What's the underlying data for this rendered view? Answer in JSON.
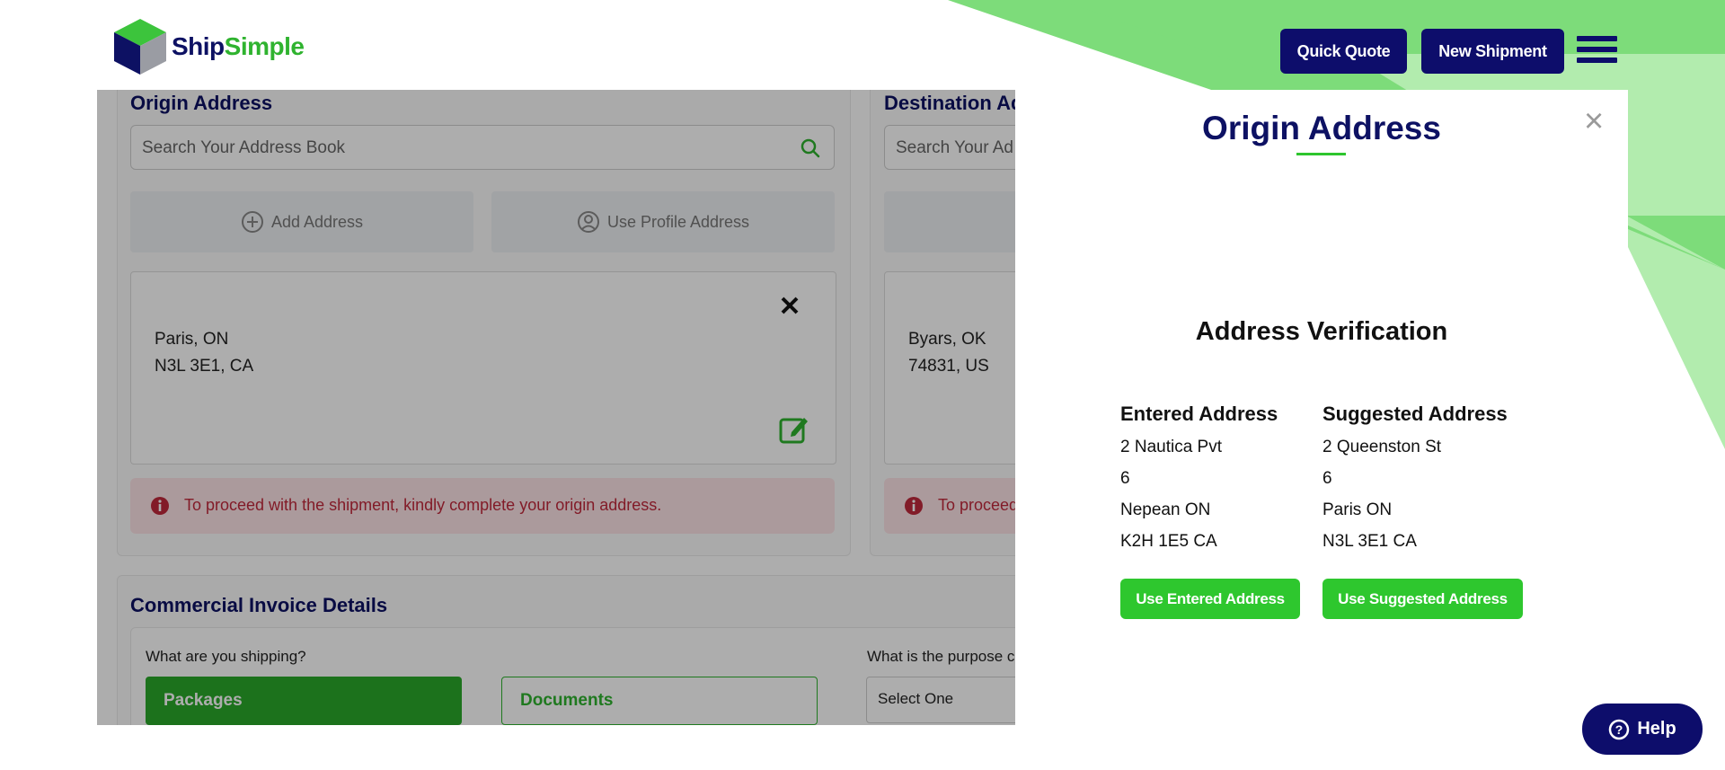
{
  "brand": {
    "name_part1": "Ship",
    "name_part2": "Simple",
    "navy": "#0d0d6b",
    "green": "#2ec72e"
  },
  "header": {
    "quick_quote": "Quick Quote",
    "new_shipment": "New Shipment"
  },
  "origin": {
    "title": "Origin Address",
    "search_placeholder": "Search Your Address Book",
    "add_address": "Add Address",
    "use_profile": "Use Profile Address",
    "address_line1": "Paris, ON",
    "address_line2": "N3L 3E1, CA",
    "alert": "To proceed with the shipment, kindly complete your origin address."
  },
  "destination": {
    "title": "Destination Ad",
    "search_placeholder": "Search Your Ad",
    "address_line1": "Byars, OK",
    "address_line2": "74831, US",
    "alert": "To proceed"
  },
  "invoice": {
    "title": "Commercial Invoice Details",
    "shipping_question": "What are you shipping?",
    "packages": "Packages",
    "documents": "Documents",
    "purpose_question": "What is the purpose c",
    "select_placeholder": "Select One"
  },
  "modal": {
    "title": "Origin Address",
    "close": "×",
    "verification_title": "Address Verification",
    "entered": {
      "title": "Entered Address",
      "lines": [
        "2 Nautica Pvt",
        "6",
        "Nepean ON",
        "K2H 1E5 CA"
      ]
    },
    "suggested": {
      "title": "Suggested Address",
      "lines": [
        "2 Queenston St",
        "6",
        "Paris ON",
        "N3L 3E1 CA"
      ]
    },
    "use_entered": "Use Entered Address",
    "use_suggested": "Use Suggested Address"
  },
  "help": {
    "label": "Help"
  }
}
